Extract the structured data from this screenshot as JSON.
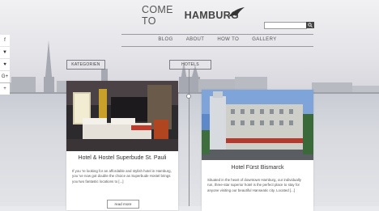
{
  "header": {
    "logo_light": "COME TO",
    "logo_bold": "HAMBURG",
    "search": {
      "placeholder": "",
      "button_icon": "search-icon"
    }
  },
  "nav": {
    "items": [
      "BLOG",
      "ABOUT",
      "HOW TO",
      "GALLERY"
    ]
  },
  "social": {
    "items": [
      "f",
      "▼",
      "♥",
      "G+",
      "+"
    ],
    "icons": [
      "facebook-icon",
      "twitter-icon",
      "pinterest-icon",
      "googleplus-icon",
      "share-icon"
    ]
  },
  "filters": {
    "categories": "KATEGORIEN",
    "hotels": "HOTELS"
  },
  "cards": [
    {
      "title": "Hotel & Hostel Superbude St. Pauli",
      "text": "If you 're looking for an affordable and stylish hotel in Hamburg, you 've now got double the choice as Superbude Hostel brings you two fantastic locations to [...]",
      "button": "read more"
    },
    {
      "title": "Hotel Fürst Bismarck",
      "text": "Situated in the heart of downtown Hamburg, our individually run, three-star superior hotel is the perfect place to stay for anyone visiting our beautiful Hanseatic city. Located [...]"
    }
  ],
  "colors": {
    "accent": "#444444",
    "line": "#8a8c94"
  }
}
